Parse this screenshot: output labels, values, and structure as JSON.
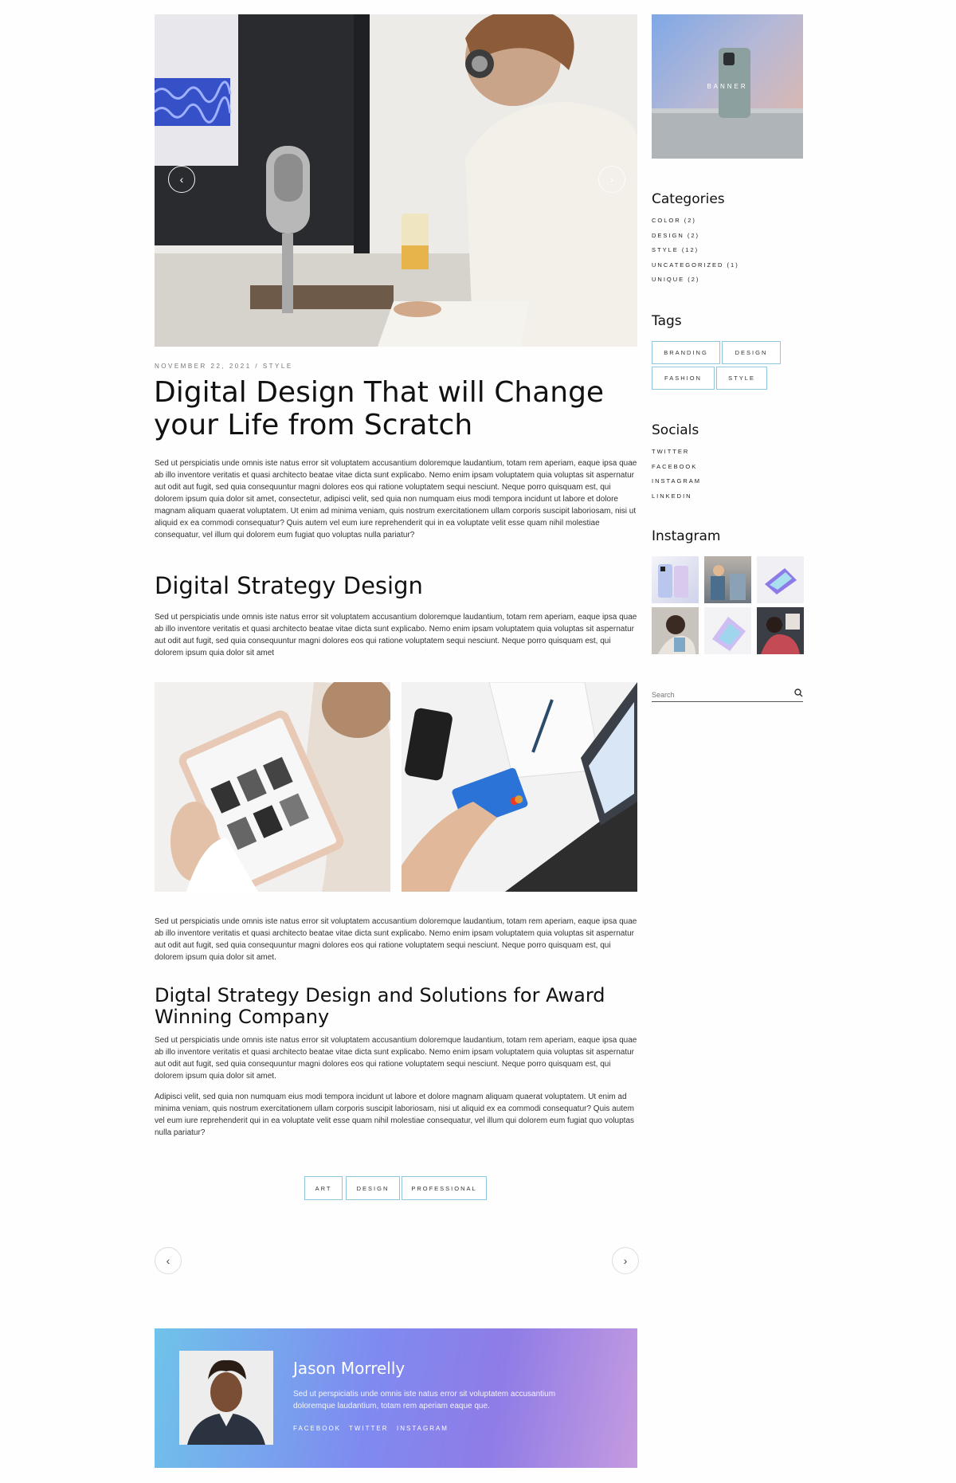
{
  "post": {
    "meta": "NOVEMBER 22, 2021 / STYLE",
    "title_line1": "Digital Design That will Change",
    "title_line2": "your Life from Scratch",
    "intro": "Sed ut perspiciatis unde omnis iste natus error sit voluptatem accusantium doloremque laudantium, totam rem aperiam, eaque ipsa quae ab illo inventore veritatis et quasi architecto beatae vitae dicta sunt explicabo. Nemo enim ipsam voluptatem quia voluptas sit aspernatur aut odit aut fugit, sed quia consequuntur magni dolores eos qui ratione voluptatem sequi nesciunt. Neque porro quisquam est, qui dolorem ipsum quia dolor sit amet, consectetur, adipisci velit, sed quia non numquam eius modi tempora incidunt ut labore et dolore magnam aliquam quaerat voluptatem. Ut enim ad minima veniam, quis nostrum exercitationem ullam corporis suscipit laboriosam, nisi ut aliquid ex ea commodi consequatur? Quis autem vel eum iure reprehenderit qui in ea voluptate velit esse quam nihil molestiae consequatur, vel illum qui dolorem eum fugiat quo voluptas nulla pariatur?",
    "h2_strategy": "Digital Strategy Design",
    "strategy_text": "Sed ut perspiciatis unde omnis iste natus error sit voluptatem accusantium doloremque laudantium, totam rem aperiam, eaque ipsa quae ab illo inventore veritatis et quasi architecto beatae vitae dicta sunt explicabo. Nemo enim ipsam voluptatem quia voluptas sit aspernatur aut odit aut fugit, sed quia consequuntur magni dolores eos qui ratione voluptatem sequi nesciunt. Neque porro quisquam est, qui dolorem ipsum quia dolor sit amet",
    "after_images_text": "Sed ut perspiciatis unde omnis iste natus error sit voluptatem accusantium doloremque laudantium, totam rem aperiam, eaque ipsa quae ab illo inventore veritatis et quasi architecto beatae vitae dicta sunt explicabo. Nemo enim ipsam voluptatem quia voluptas sit aspernatur aut odit aut fugit, sed quia consequuntur magni dolores eos qui ratione voluptatem sequi nesciunt. Neque porro quisquam est, qui dolorem ipsum quia dolor sit amet.",
    "h3_award_line1": "Digtal Strategy Design and Solutions for Award",
    "h3_award_line2": "Winning Company",
    "award_text1": "Sed ut perspiciatis unde omnis iste natus error sit voluptatem accusantium doloremque laudantium, totam rem aperiam, eaque ipsa quae ab illo inventore veritatis et quasi architecto beatae vitae dicta sunt explicabo. Nemo enim ipsam voluptatem quia voluptas sit aspernatur aut odit aut fugit, sed quia consequuntur magni dolores eos qui ratione voluptatem sequi nesciunt. Neque porro quisquam est, qui dolorem ipsum quia dolor sit amet.",
    "award_text2": "Adipisci velit, sed quia non numquam eius modi tempora incidunt ut labore et dolore magnam aliquam quaerat voluptatem. Ut enim ad minima veniam, quis nostrum exercitationem ullam corporis suscipit laboriosam, nisi ut aliquid ex ea commodi consequatur? Quis autem vel eum iure reprehenderit qui in ea voluptate velit esse quam nihil molestiae consequatur, vel illum qui dolorem eum fugiat quo voluptas nulla pariatur?",
    "tags": [
      "ART",
      "DESIGN",
      "PROFESSIONAL"
    ]
  },
  "slider": {
    "prev_icon": "chevron-left-icon",
    "next_icon": "chevron-right-icon"
  },
  "author": {
    "name": "Jason Morrelly",
    "bio": "Sed ut perspiciatis unde omnis iste natus error sit voluptatem accusantium doloremque laudantium, totam rem aperiam eaque que.",
    "links": [
      "FACEBOOK",
      "TWITTER",
      "INSTAGRAM"
    ]
  },
  "sidebar": {
    "banner_label": "BANNER",
    "categories_title": "Categories",
    "categories": [
      "COLOR (2)",
      "DESIGN (2)",
      "STYLE (12)",
      "UNCATEGORIZED (1)",
      "UNIQUE (2)"
    ],
    "tags_title": "Tags",
    "tags": [
      "BRANDING",
      "DESIGN",
      "FASHION",
      "STYLE"
    ],
    "socials_title": "Socials",
    "socials": [
      "TWITTER",
      "FACEBOOK",
      "INSTAGRAM",
      "LINKEDIN"
    ],
    "instagram_title": "Instagram",
    "search_placeholder": "Search"
  },
  "colors": {
    "accent_border": "#8fc7dd",
    "author_gradient_start": "#6fc3ea",
    "author_gradient_mid": "#7b7ef0",
    "author_gradient_end": "#c59be0"
  }
}
